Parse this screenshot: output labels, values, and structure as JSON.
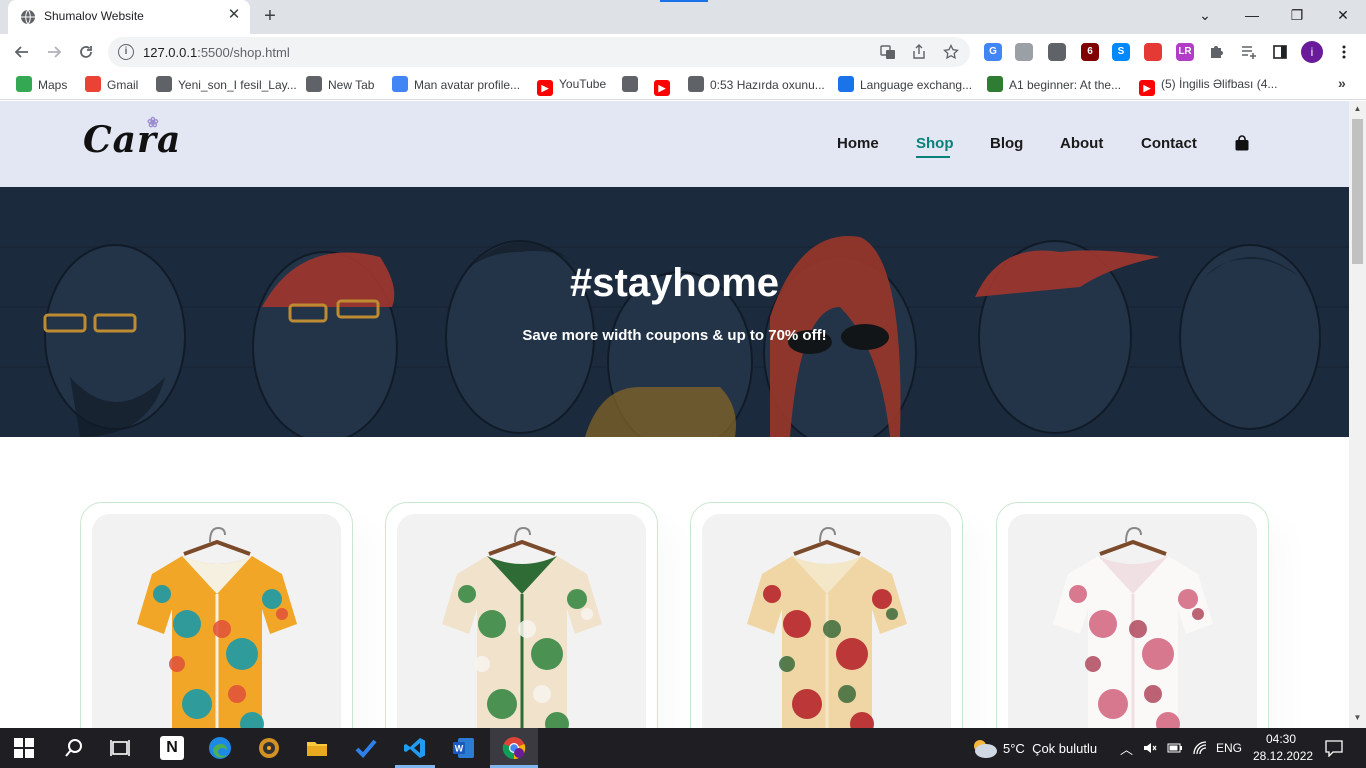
{
  "browser": {
    "tab": {
      "title": "Shumalov Website"
    },
    "new_tab_symbol": "+",
    "window_controls": {
      "minimize": "—",
      "restore": "❐",
      "close": "✕"
    },
    "tab_search_symbol": "⌄",
    "omnibox": {
      "host": "127.0.0.1",
      "path": ":5500/shop.html"
    },
    "profile_initial": "i",
    "extensions": [
      {
        "name": "translate-icon",
        "color": "#4285f4",
        "text": "G"
      },
      {
        "name": "shield-ext-icon",
        "color": "#9aa0a6",
        "text": ""
      },
      {
        "name": "tools-ext-icon",
        "color": "#5f6368",
        "text": ""
      },
      {
        "name": "ublock-icon",
        "color": "#800000",
        "text": "6"
      },
      {
        "name": "shazam-icon",
        "color": "#0088ff",
        "text": "S"
      },
      {
        "name": "red-ext-icon",
        "color": "#e53935",
        "text": ""
      },
      {
        "name": "lr-ext-icon",
        "color": "#b23cc8",
        "text": "LR"
      }
    ],
    "bookmarks": [
      {
        "label": "Maps",
        "icon": "maps-icon",
        "color": "#34a853"
      },
      {
        "label": "Gmail",
        "icon": "gmail-icon",
        "color": "#ea4335"
      },
      {
        "label": "Yeni_son_I fesil_Lay...",
        "icon": "globe-icon",
        "color": "#5f6368"
      },
      {
        "label": "New Tab",
        "icon": "globe-icon",
        "color": "#5f6368"
      },
      {
        "label": "Man avatar profile...",
        "icon": "google-icon",
        "color": "#4285f4"
      },
      {
        "label": "YouTube",
        "icon": "youtube-icon",
        "color": "#ff0000"
      },
      {
        "label": "",
        "icon": "globe-icon",
        "color": "#5f6368"
      },
      {
        "label": "",
        "icon": "youtube-icon",
        "color": "#ff0000"
      },
      {
        "label": "0:53 Hazırda oxunu...",
        "icon": "globe-icon",
        "color": "#5f6368"
      },
      {
        "label": "Language exchang...",
        "icon": "chat-icon",
        "color": "#1a73e8"
      },
      {
        "label": "A1 beginner: At the...",
        "icon": "clover-icon",
        "color": "#2e7d32"
      },
      {
        "label": "(5) İngilis Əlifbası (4...",
        "icon": "youtube-icon",
        "color": "#ff0000"
      }
    ],
    "bookmarks_overflow": "»"
  },
  "site": {
    "logo": "Cara",
    "nav": [
      {
        "label": "Home",
        "active": false
      },
      {
        "label": "Shop",
        "active": true
      },
      {
        "label": "Blog",
        "active": false
      },
      {
        "label": "About",
        "active": false
      },
      {
        "label": "Contact",
        "active": false
      }
    ],
    "hero": {
      "title": "#stayhome",
      "subtitle": "Save more width coupons & up to 70% off!"
    },
    "products": [
      {
        "name": "colorful-abstract-shirt",
        "colors": [
          "#f2a627",
          "#1b9aa8",
          "#e0503a",
          "#f5f0e0"
        ]
      },
      {
        "name": "palm-leaf-shirt",
        "colors": [
          "#f1e2cc",
          "#3a8a45",
          "#f7f5ef",
          "#2f6b35"
        ]
      },
      {
        "name": "red-floral-shirt",
        "colors": [
          "#efd6a4",
          "#b7262d",
          "#3d6b3c",
          "#f3e7c8"
        ]
      },
      {
        "name": "pink-blossom-shirt",
        "colors": [
          "#fbf8f8",
          "#d46b84",
          "#b04a5d",
          "#f0dfe3"
        ]
      }
    ]
  },
  "taskbar": {
    "weather": {
      "temp": "5°C",
      "desc": "Çok bulutlu"
    },
    "lang": "ENG",
    "time": "04:30",
    "date": "28.12.2022"
  }
}
